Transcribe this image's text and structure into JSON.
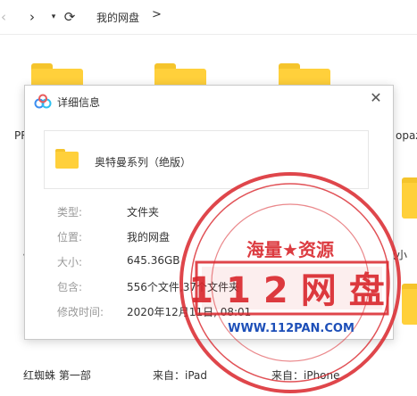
{
  "nav": {
    "back_icon": "‹",
    "forward_icon": "›",
    "dropdown_icon": "▾",
    "refresh_icon": "⟳",
    "breadcrumb": "我的网盘",
    "breadcrumb_sep": ">"
  },
  "background": {
    "labels": [
      "PR",
      "opaz",
      "《",
      "灭小",
      "红蜘蛛 第一部",
      "来自：iPad",
      "来自：iPhone"
    ]
  },
  "dialog": {
    "title": "详细信息",
    "close_icon": "✕",
    "file_name": "奥特曼系列（绝版）",
    "properties": [
      {
        "label": "类型:",
        "value": "文件夹"
      },
      {
        "label": "位置:",
        "value": "我的网盘"
      },
      {
        "label": "大小:",
        "value": "645.36GB"
      },
      {
        "label": "包含:",
        "value": "556个文件,37个文件夹"
      },
      {
        "label": "修改时间:",
        "value": "2020年12月11日, 08:01"
      }
    ]
  },
  "watermark": {
    "top_text": "海量★资源",
    "main_text": "112网盘",
    "url": "WWW.112PAN.COM"
  },
  "colors": {
    "folder": "#ffd03b",
    "folder_tab": "#f5c42c",
    "stamp": "#d9262c",
    "stamp_blue": "#1d4fb8"
  }
}
